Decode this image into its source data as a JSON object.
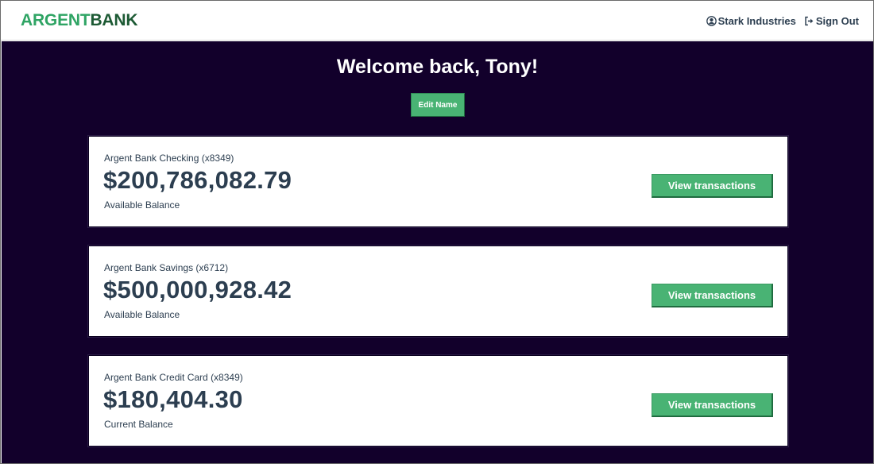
{
  "brand": {
    "logo_part1": "ARGENT",
    "logo_part2": "BANK",
    "colors": {
      "green_light": "#2fa464",
      "green_dark": "#1d5a34",
      "button": "#49b374",
      "background": "#12002b"
    }
  },
  "nav": {
    "user_label": "Stark Industries",
    "user_icon": "user-circle-icon",
    "signout_label": "Sign Out",
    "signout_icon": "sign-out-icon"
  },
  "header": {
    "welcome": "Welcome back, Tony!",
    "edit_button": "Edit Name"
  },
  "accounts": [
    {
      "title": "Argent Bank Checking (x8349)",
      "amount": "$200,786,082.79",
      "description": "Available Balance",
      "button": "View transactions"
    },
    {
      "title": "Argent Bank Savings (x6712)",
      "amount": "$500,000,928.42",
      "description": "Available Balance",
      "button": "View transactions"
    },
    {
      "title": "Argent Bank Credit Card (x8349)",
      "amount": "$180,404.30",
      "description": "Current Balance",
      "button": "View transactions"
    }
  ]
}
